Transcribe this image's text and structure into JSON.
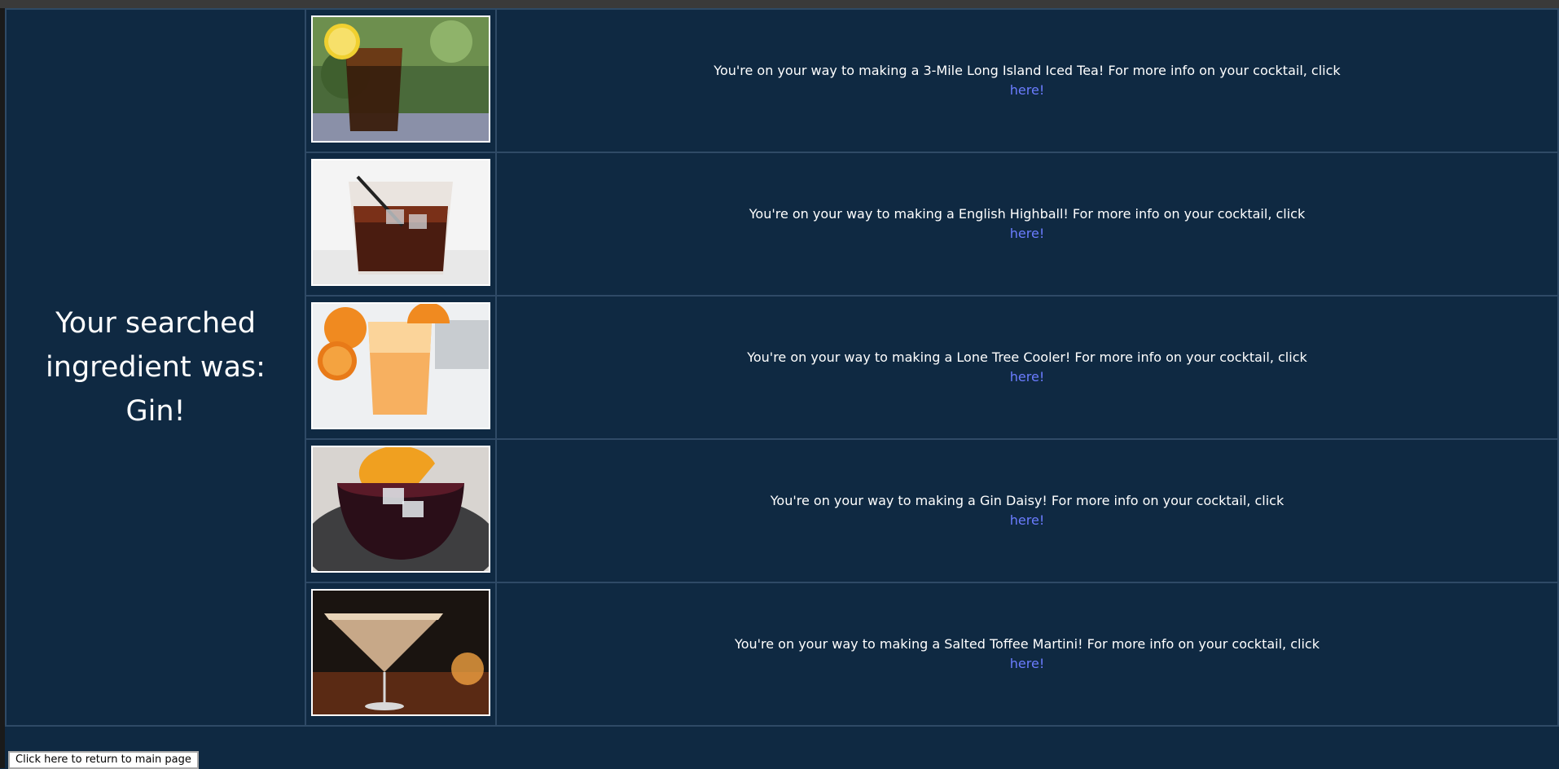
{
  "ingredient_heading": "Your searched ingredient was: Gin!",
  "results": [
    {
      "message": "You're on your way to making a 3-Mile Long Island Iced Tea! For more info on your cocktail, click",
      "link_label": "here!",
      "image_icon": "iced-tea-glass-image"
    },
    {
      "message": "You're on your way to making a English Highball! For more info on your cocktail, click",
      "link_label": "here!",
      "image_icon": "highball-glass-image"
    },
    {
      "message": "You're on your way to making a Lone Tree Cooler! For more info on your cocktail, click",
      "link_label": "here!",
      "image_icon": "orange-cooler-image"
    },
    {
      "message": "You're on your way to making a Gin Daisy! For more info on your cocktail, click",
      "link_label": "here!",
      "image_icon": "gin-daisy-image"
    },
    {
      "message": "You're on your way to making a Salted Toffee Martini! For more info on your cocktail, click",
      "link_label": "here!",
      "image_icon": "martini-glass-image"
    }
  ],
  "return_button_label": "Click here to return to main page",
  "colors": {
    "background": "#0f2942",
    "border": "#2f4a66",
    "link": "#6b7cff",
    "text": "#ffffff"
  }
}
